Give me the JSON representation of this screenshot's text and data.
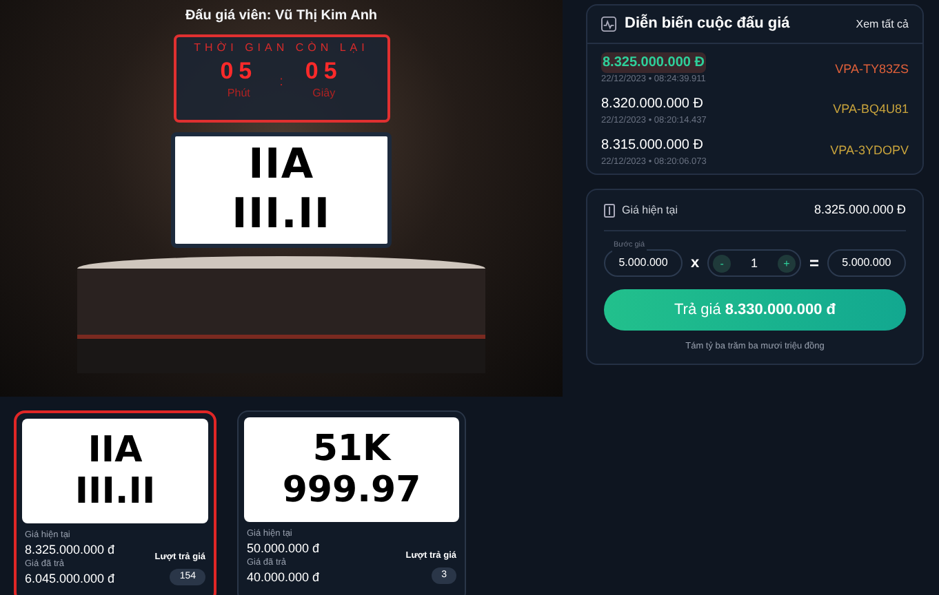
{
  "stage": {
    "auctioneer": "Đấu giá viên: Vũ Thị Kim Anh",
    "timer": {
      "title": "THỜI GIAN CÒN LẠI",
      "minutes": "05",
      "minutes_label": "Phút",
      "separator": ":",
      "seconds": "05",
      "seconds_label": "Giây"
    },
    "plate": {
      "line1": "IIA",
      "line2": "III.II"
    }
  },
  "history": {
    "title": "Diễn biến cuộc đấu giá",
    "see_all": "Xem tất cả",
    "bids": [
      {
        "amount": "8.325.000.000 Đ",
        "time": "22/12/2023 • 08:24:39.911",
        "bidder": "VPA-TY83ZS",
        "leading": true,
        "color": "#e0603a"
      },
      {
        "amount": "8.320.000.000 Đ",
        "time": "22/12/2023 • 08:20:14.437",
        "bidder": "VPA-BQ4U81",
        "leading": false,
        "color": "#c9a43c"
      },
      {
        "amount": "8.315.000.000 Đ",
        "time": "22/12/2023 • 08:20:06.073",
        "bidder": "VPA-3YDOPV",
        "leading": false,
        "color": "#c9a43c"
      }
    ]
  },
  "bid_panel": {
    "current_label": "Giá hiện tại",
    "current_value": "8.325.000.000 Đ",
    "step_label": "Bước giá",
    "step_value": "5.000.000",
    "times": "x",
    "minus": "-",
    "quantity": "1",
    "plus": "+",
    "equals": "=",
    "total": "5.000.000",
    "button_prefix": "Trả giá",
    "button_amount": "8.330.000.000 đ",
    "amount_words": "Tám tỷ ba trăm ba mươi triệu đồng"
  },
  "cards": [
    {
      "line1": "IIA",
      "line2": "III.II",
      "current_label": "Giá hiện tại",
      "current_value": "8.325.000.000 đ",
      "paid_label": "Giá đã trả",
      "paid_value": "6.045.000.000 đ",
      "bids_label": "Lượt trả giá",
      "bids_count": "154",
      "selected": true
    },
    {
      "line1": "51K",
      "line2": "999.97",
      "current_label": "Giá hiện tại",
      "current_value": "50.000.000 đ",
      "paid_label": "Giá đã trả",
      "paid_value": "40.000.000 đ",
      "bids_label": "Lượt trả giá",
      "bids_count": "3",
      "selected": false
    }
  ]
}
